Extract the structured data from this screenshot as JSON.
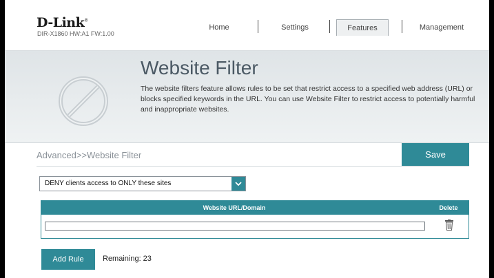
{
  "brand": {
    "logo": "D-Link",
    "registered_mark": "®",
    "firmware_info": "DIR-X1860 HW:A1 FW:1.00"
  },
  "nav": {
    "home": "Home",
    "settings": "Settings",
    "features": "Features",
    "management": "Management",
    "active": "Features"
  },
  "banner": {
    "icon": "no-entry-icon",
    "title": "Website Filter",
    "description": "The website filters feature allows rules to be set that restrict access to a specified web address (URL) or blocks specified keywords in the URL. You can use Website Filter to restrict access to potentially harmful and inappropriate websites."
  },
  "breadcrumb": "Advanced>>Website Filter",
  "save_label": "Save",
  "filter_mode": {
    "selected": "DENY clients access to ONLY these sites",
    "arrow_icon": "chevron-down-icon"
  },
  "table": {
    "columns": [
      "Website URL/Domain",
      "Delete"
    ],
    "rows": [
      {
        "url": "",
        "delete_icon": "trash-icon"
      }
    ]
  },
  "add_rule_label": "Add Rule",
  "remaining": {
    "label": "Remaining:",
    "value": "23"
  },
  "colors": {
    "accent": "#2f8a97",
    "banner_bg": "#e4e8ea",
    "title": "#4b5964"
  }
}
